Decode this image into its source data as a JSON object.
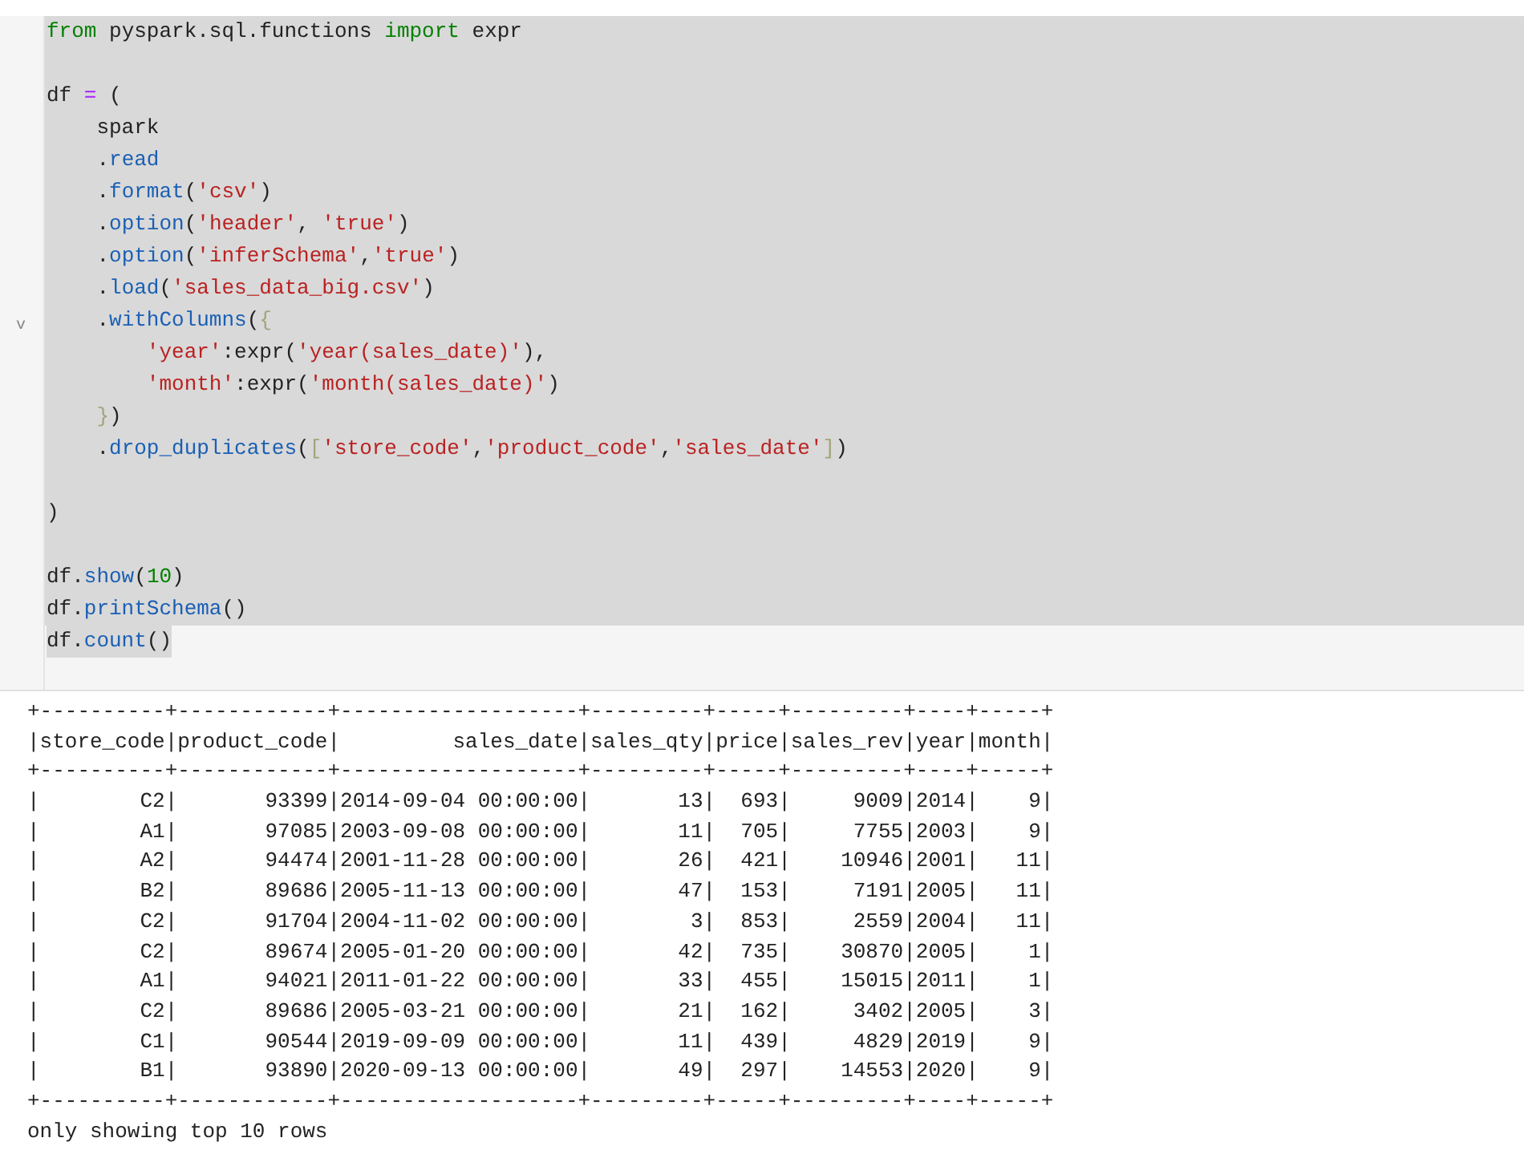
{
  "code_cell": {
    "fold_marker": "v",
    "lines": [
      {
        "kind": "code",
        "tokens": [
          {
            "kind": "keyword",
            "text": "from"
          },
          {
            "kind": "plain",
            "text": " pyspark.sql.functions "
          },
          {
            "kind": "keyword",
            "text": "import"
          },
          {
            "kind": "plain",
            "text": " expr"
          }
        ]
      },
      {
        "kind": "blank"
      },
      {
        "kind": "code",
        "tokens": [
          {
            "kind": "plain",
            "text": "df "
          },
          {
            "kind": "operator",
            "text": "="
          },
          {
            "kind": "plain",
            "text": " ("
          }
        ]
      },
      {
        "kind": "code",
        "tokens": [
          {
            "kind": "plain",
            "text": "    spark"
          }
        ]
      },
      {
        "kind": "code",
        "tokens": [
          {
            "kind": "plain",
            "text": "    ."
          },
          {
            "kind": "method",
            "text": "read"
          }
        ]
      },
      {
        "kind": "code",
        "tokens": [
          {
            "kind": "plain",
            "text": "    ."
          },
          {
            "kind": "method",
            "text": "format"
          },
          {
            "kind": "plain",
            "text": "("
          },
          {
            "kind": "string",
            "text": "'csv'"
          },
          {
            "kind": "plain",
            "text": ")"
          }
        ]
      },
      {
        "kind": "code",
        "tokens": [
          {
            "kind": "plain",
            "text": "    ."
          },
          {
            "kind": "method",
            "text": "option"
          },
          {
            "kind": "plain",
            "text": "("
          },
          {
            "kind": "string",
            "text": "'header'"
          },
          {
            "kind": "plain",
            "text": ", "
          },
          {
            "kind": "string",
            "text": "'true'"
          },
          {
            "kind": "plain",
            "text": ")"
          }
        ]
      },
      {
        "kind": "code",
        "tokens": [
          {
            "kind": "plain",
            "text": "    ."
          },
          {
            "kind": "method",
            "text": "option"
          },
          {
            "kind": "plain",
            "text": "("
          },
          {
            "kind": "string",
            "text": "'inferSchema'"
          },
          {
            "kind": "plain",
            "text": ","
          },
          {
            "kind": "string",
            "text": "'true'"
          },
          {
            "kind": "plain",
            "text": ")"
          }
        ]
      },
      {
        "kind": "code",
        "tokens": [
          {
            "kind": "plain",
            "text": "    ."
          },
          {
            "kind": "method",
            "text": "load"
          },
          {
            "kind": "plain",
            "text": "("
          },
          {
            "kind": "string",
            "text": "'sales_data_big.csv'"
          },
          {
            "kind": "plain",
            "text": ")"
          }
        ]
      },
      {
        "kind": "code",
        "tokens": [
          {
            "kind": "plain",
            "text": "    ."
          },
          {
            "kind": "method",
            "text": "withColumns"
          },
          {
            "kind": "plain",
            "text": "("
          },
          {
            "kind": "bracket",
            "text": "{"
          }
        ]
      },
      {
        "kind": "code",
        "tokens": [
          {
            "kind": "string",
            "text": "        'year'"
          },
          {
            "kind": "plain",
            "text": ":expr("
          },
          {
            "kind": "string",
            "text": "'year(sales_date)'"
          },
          {
            "kind": "plain",
            "text": "),"
          }
        ]
      },
      {
        "kind": "code",
        "tokens": [
          {
            "kind": "string",
            "text": "        'month'"
          },
          {
            "kind": "plain",
            "text": ":expr("
          },
          {
            "kind": "string",
            "text": "'month(sales_date)'"
          },
          {
            "kind": "plain",
            "text": ")"
          }
        ]
      },
      {
        "kind": "code",
        "tokens": [
          {
            "kind": "bracket",
            "text": "    }"
          },
          {
            "kind": "plain",
            "text": ")"
          }
        ]
      },
      {
        "kind": "code",
        "tokens": [
          {
            "kind": "plain",
            "text": "    ."
          },
          {
            "kind": "method",
            "text": "drop_duplicates"
          },
          {
            "kind": "plain",
            "text": "("
          },
          {
            "kind": "bracket",
            "text": "["
          },
          {
            "kind": "string",
            "text": "'store_code'"
          },
          {
            "kind": "plain",
            "text": ","
          },
          {
            "kind": "string",
            "text": "'product_code'"
          },
          {
            "kind": "plain",
            "text": ","
          },
          {
            "kind": "string",
            "text": "'sales_date'"
          },
          {
            "kind": "bracket",
            "text": "]"
          },
          {
            "kind": "plain",
            "text": ")"
          }
        ]
      },
      {
        "kind": "blank"
      },
      {
        "kind": "code",
        "tokens": [
          {
            "kind": "plain",
            "text": ")"
          }
        ]
      },
      {
        "kind": "blank"
      },
      {
        "kind": "code",
        "tokens": [
          {
            "kind": "plain",
            "text": "df."
          },
          {
            "kind": "method",
            "text": "show"
          },
          {
            "kind": "plain",
            "text": "("
          },
          {
            "kind": "number",
            "text": "10"
          },
          {
            "kind": "plain",
            "text": ")"
          }
        ]
      },
      {
        "kind": "code",
        "tokens": [
          {
            "kind": "plain",
            "text": "df."
          },
          {
            "kind": "method",
            "text": "printSchema"
          },
          {
            "kind": "plain",
            "text": "()"
          }
        ]
      },
      {
        "kind": "code",
        "tokens": [
          {
            "kind": "plain",
            "text": "df."
          },
          {
            "kind": "method",
            "text": "count"
          },
          {
            "kind": "plain",
            "text": "()"
          }
        ]
      }
    ]
  },
  "output": {
    "lines": [
      "+----------+------------+-------------------+---------+-----+---------+----+-----+",
      "|store_code|product_code|         sales_date|sales_qty|price|sales_rev|year|month|",
      "+----------+------------+-------------------+---------+-----+---------+----+-----+",
      "|        C2|       93399|2014-09-04 00:00:00|       13|  693|     9009|2014|    9|",
      "|        A1|       97085|2003-09-08 00:00:00|       11|  705|     7755|2003|    9|",
      "|        A2|       94474|2001-11-28 00:00:00|       26|  421|    10946|2001|   11|",
      "|        B2|       89686|2005-11-13 00:00:00|       47|  153|     7191|2005|   11|",
      "|        C2|       91704|2004-11-02 00:00:00|        3|  853|     2559|2004|   11|",
      "|        C2|       89674|2005-01-20 00:00:00|       42|  735|    30870|2005|    1|",
      "|        A1|       94021|2011-01-22 00:00:00|       33|  455|    15015|2011|    1|",
      "|        C2|       89686|2005-03-21 00:00:00|       21|  162|     3402|2005|    3|",
      "|        C1|       90544|2019-09-09 00:00:00|       11|  439|     4829|2019|    9|",
      "|        B1|       93890|2020-09-13 00:00:00|       49|  297|    14553|2020|    9|",
      "+----------+------------+-------------------+---------+-----+---------+----+-----+",
      "only showing top 10 rows"
    ]
  }
}
